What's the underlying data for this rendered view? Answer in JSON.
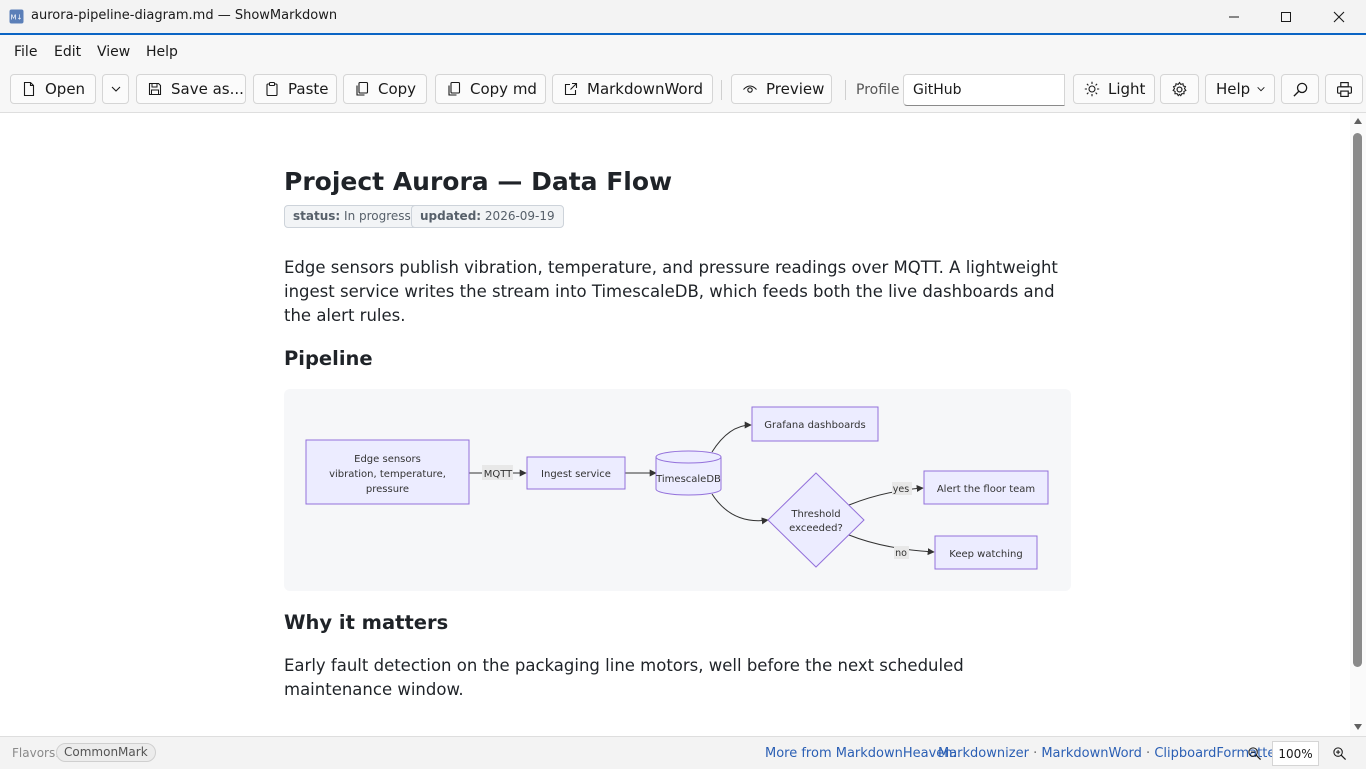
{
  "window": {
    "title": "aurora-pipeline-diagram.md — ShowMarkdown",
    "app_icon_text": "M↓"
  },
  "menu": [
    "File",
    "Edit",
    "View",
    "Help"
  ],
  "toolbar": {
    "open": "Open",
    "save_as": "Save as...",
    "paste": "Paste",
    "copy": "Copy",
    "copy_md": "Copy md",
    "markdown_word": "MarkdownWord",
    "preview": "Preview",
    "profile_label": "Profile",
    "profile_value": "GitHub",
    "theme": "Light",
    "help": "Help"
  },
  "document": {
    "title": "Project Aurora — Data Flow",
    "badges": [
      {
        "key": "status:",
        "value": "In progress"
      },
      {
        "key": "updated:",
        "value": "2026-09-19"
      }
    ],
    "intro": "Edge sensors publish vibration, temperature, and pressure readings over MQTT. A lightweight ingest service writes the stream into TimescaleDB, which feeds both the live dashboards and the alert rules.",
    "section1_heading": "Pipeline",
    "diagram": {
      "nodes": {
        "edge_sensors": [
          "Edge sensors",
          "vibration, temperature,",
          "pressure"
        ],
        "ingest": "Ingest service",
        "db": "TimescaleDB",
        "grafana": "Grafana dashboards",
        "decision": [
          "Threshold",
          "exceeded?"
        ],
        "alert": "Alert the floor team",
        "keep": "Keep watching"
      },
      "edge_labels": {
        "mqtt": "MQTT",
        "yes": "yes",
        "no": "no"
      },
      "colors": {
        "node_fill": "#ececff",
        "node_stroke": "#9370db",
        "line": "#333333"
      }
    },
    "section2_heading": "Why it matters",
    "why": "Early fault detection on the packaging line motors, well before the next scheduled maintenance window."
  },
  "status": {
    "flavors_label": "Flavors:",
    "flavor": "CommonMark",
    "more_from": "More from MarkdownHeaven:",
    "links": [
      "Markdownizer",
      "MarkdownWord",
      "ClipboardFormatter"
    ],
    "zoom": "100%"
  }
}
